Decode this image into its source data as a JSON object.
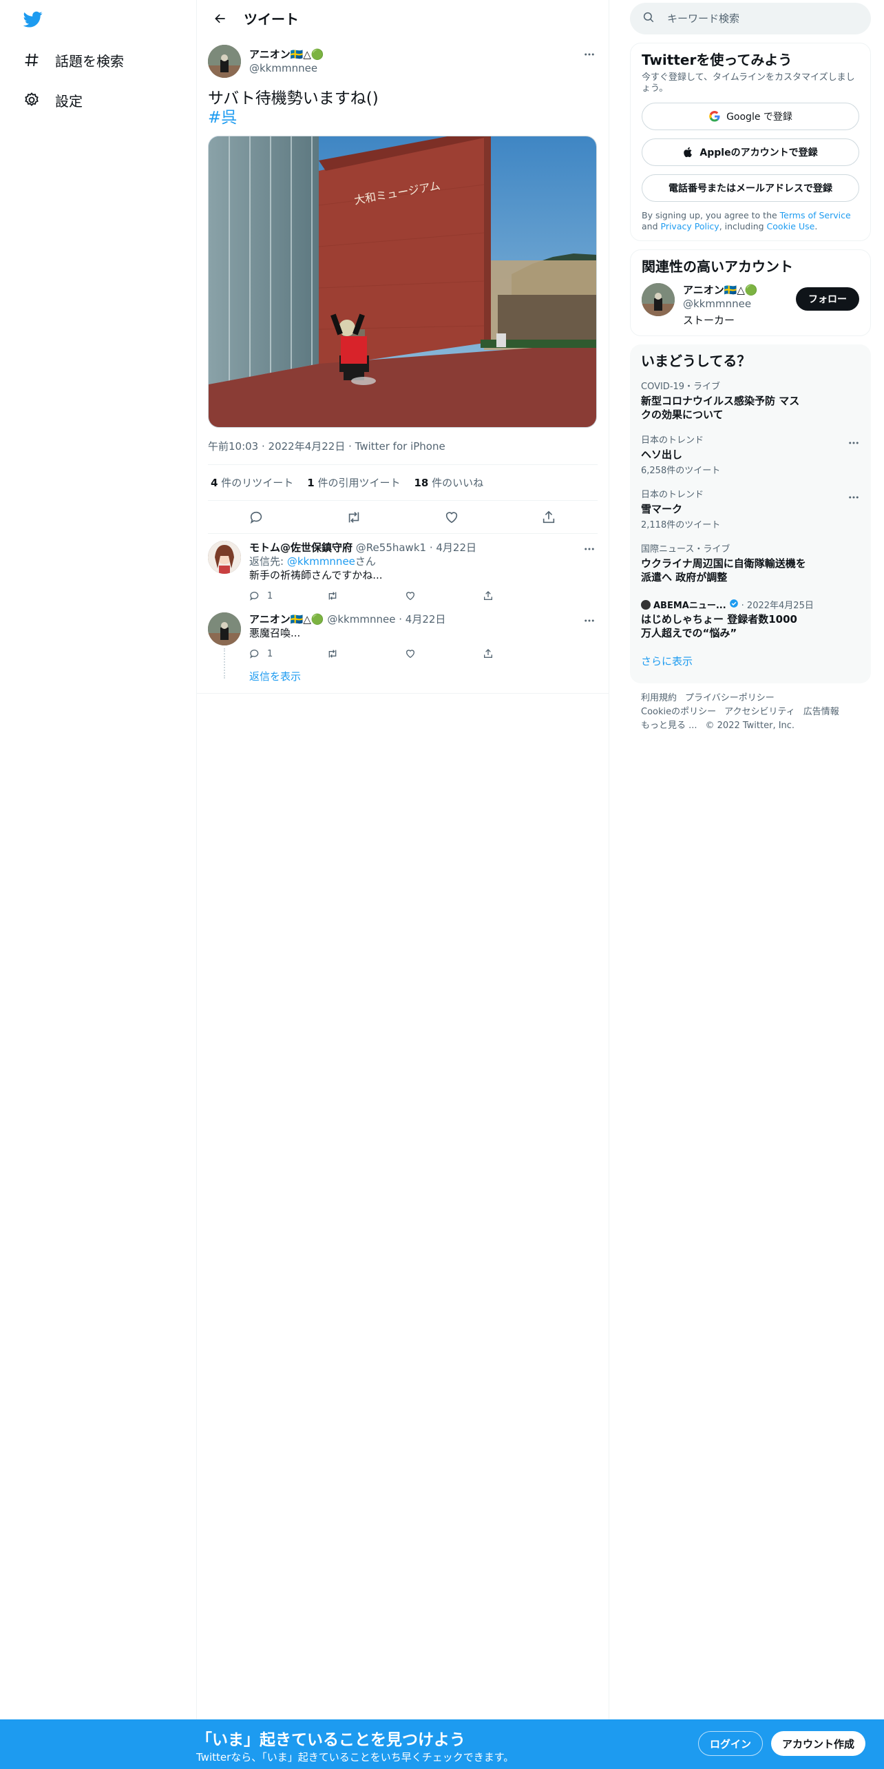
{
  "nav": {
    "explore_label": "話題を検索",
    "settings_label": "設定"
  },
  "header": {
    "title": "ツイート"
  },
  "tweet": {
    "author_name": "アニオン🇸🇪△🟢",
    "author_handle": "@kkmmnnee",
    "text": "サバト待機勢いますね()",
    "hashtag": "#呉",
    "image_sign_text": "大和ミュージアム",
    "meta": "午前10:03 · 2022年4月22日 · Twitter for iPhone",
    "stats": [
      {
        "count": "4",
        "label": "件のリツイート"
      },
      {
        "count": "1",
        "label": "件の引用ツイート"
      },
      {
        "count": "18",
        "label": "件のいいね"
      }
    ]
  },
  "replies": [
    {
      "name": "モトム@佐世保鎮守府",
      "handle": "@Re55hawk1",
      "date": "· 4月22日",
      "reply_to_prefix": "返信先: ",
      "reply_to_handle": "@kkmmnnee",
      "reply_to_suffix": "さん",
      "text": "新手の祈祷師さんですかね...",
      "reply_count": "1"
    },
    {
      "name": "アニオン🇸🇪△🟢",
      "handle": "@kkmmnnee",
      "date": "· 4月22日",
      "text": "悪魔召喚...",
      "reply_count": "1"
    }
  ],
  "show_replies": "返信を表示",
  "search": {
    "placeholder": "キーワード検索"
  },
  "signup": {
    "title": "Twitterを使ってみよう",
    "subtitle": "今すぐ登録して、タイムラインをカスタマイズしましょう。",
    "google": "Google で登録",
    "apple": "Appleのアカウントで登録",
    "phone": "電話番号またはメールアドレスで登録",
    "legal_1": "By signing up, you agree to the ",
    "terms": "Terms of Service",
    "legal_2": " and ",
    "privacy": "Privacy Policy",
    "legal_3": ", including ",
    "cookie": "Cookie Use",
    "legal_4": "."
  },
  "related": {
    "title": "関連性の高いアカウント",
    "name": "アニオン🇸🇪△🟢",
    "handle": "@kkmmnnee",
    "bio": "ストーカー",
    "follow": "フォロー"
  },
  "trends": {
    "title": "いまどうしてる？",
    "items": [
      {
        "category": "COVID-19・ライブ",
        "title": "新型コロナウイルス感染予防 マスクの効果について"
      },
      {
        "category": "日本のトレンド",
        "title": "ヘソ出し",
        "count": "6,258件のツイート"
      },
      {
        "category": "日本のトレンド",
        "title": "雪マーク",
        "count": "2,118件のツイート"
      },
      {
        "category": "国際ニュース・ライブ",
        "title": "ウクライナ周辺国に自衛隊輸送機を派遣へ 政府が調整"
      },
      {
        "source": "ABEMAニュー...",
        "date": "· 2022年4月25日",
        "title": "はじめしゃちょー 登録者数1000万人超えでの“悩み”"
      }
    ],
    "show_more": "さらに表示"
  },
  "footer": {
    "links": [
      "利用規約",
      "プライバシーポリシー",
      "Cookieのポリシー",
      "アクセシビリティ",
      "広告情報",
      "もっと見る ..."
    ],
    "copyright": "© 2022 Twitter, Inc."
  },
  "bottom": {
    "title": "「いま」起きていることを見つけよう",
    "subtitle": "Twitterなら、「いま」起きていることをいち早くチェックできます。",
    "login": "ログイン",
    "signup": "アカウント作成"
  },
  "colors": {
    "accent": "#1d9bf0",
    "text": "#0f1419",
    "muted": "#536471"
  },
  "icons": [
    "twitter-logo-icon",
    "hashtag-icon",
    "gear-icon",
    "back-arrow-icon",
    "more-icon",
    "reply-icon",
    "retweet-icon",
    "like-icon",
    "share-icon",
    "search-icon",
    "google-icon",
    "apple-icon",
    "verified-icon"
  ]
}
